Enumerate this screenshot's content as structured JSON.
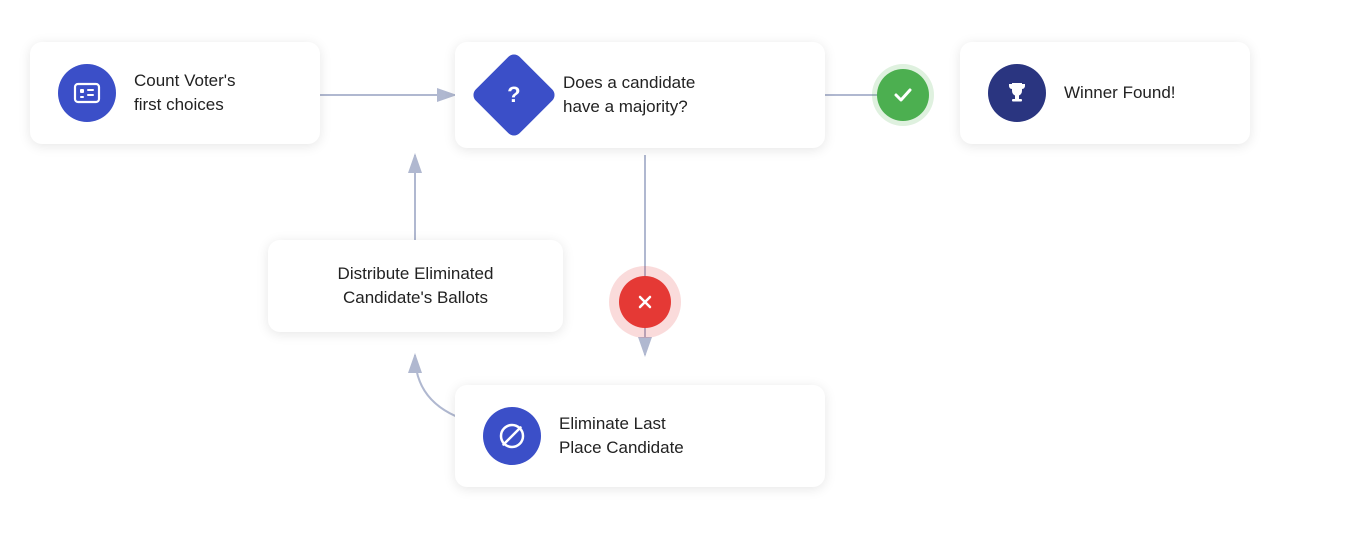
{
  "nodes": {
    "count_voters": {
      "label": "Count Voter's\nfirst choices",
      "icon": "ballot-icon",
      "icon_char": "▦"
    },
    "majority_question": {
      "label": "Does a candidate\nhave a majority?",
      "icon": "question-icon",
      "icon_char": "?"
    },
    "winner": {
      "label": "Winner Found!",
      "icon": "trophy-icon",
      "icon_char": "🏆"
    },
    "distribute": {
      "label": "Distribute Eliminated\nCandidate's Ballots"
    },
    "eliminate": {
      "label": "Eliminate Last\nPlace Candidate",
      "icon": "ban-icon",
      "icon_char": "⊘"
    }
  },
  "arrows": {
    "yes_label": "Yes",
    "no_label": "No"
  },
  "colors": {
    "blue": "#3b4fc8",
    "navy": "#2a3580",
    "green": "#4caf50",
    "red": "#e53935",
    "arrow": "#b0b8d0"
  }
}
